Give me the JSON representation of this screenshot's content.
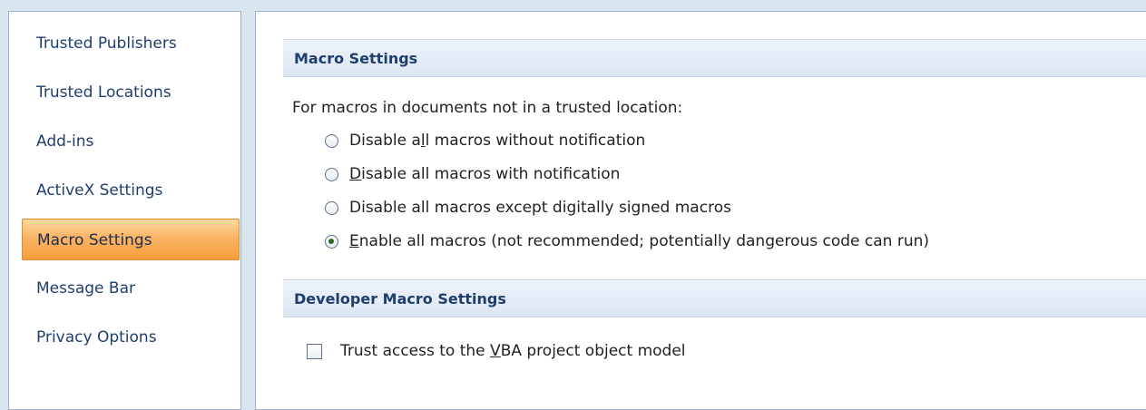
{
  "sidebar": {
    "items": [
      {
        "label": "Trusted Publishers",
        "selected": false
      },
      {
        "label": "Trusted Locations",
        "selected": false
      },
      {
        "label": "Add-ins",
        "selected": false
      },
      {
        "label": "ActiveX Settings",
        "selected": false
      },
      {
        "label": "Macro Settings",
        "selected": true
      },
      {
        "label": "Message Bar",
        "selected": false
      },
      {
        "label": "Privacy Options",
        "selected": false
      }
    ]
  },
  "macro_settings": {
    "header": "Macro Settings",
    "intro": "For macros in documents not in a trusted location:",
    "options": [
      {
        "pre": "Disable a",
        "accel": "l",
        "post": "l macros without notification",
        "checked": false
      },
      {
        "pre": "",
        "accel": "D",
        "post": "isable all macros with notification",
        "checked": false
      },
      {
        "pre": "Disable all macros except di",
        "accel": "g",
        "post": "itally signed macros",
        "checked": false
      },
      {
        "pre": "",
        "accel": "E",
        "post": "nable all macros (not recommended; potentially dangerous code can run)",
        "checked": true
      }
    ]
  },
  "developer": {
    "header": "Developer Macro Settings",
    "checkbox": {
      "pre": "Trust access to the ",
      "accel": "V",
      "post": "BA project object model",
      "checked": false
    }
  },
  "colors": {
    "selected_nav": "#f9b466",
    "header_text": "#1e3f6e",
    "background": "#d9e4f1"
  }
}
